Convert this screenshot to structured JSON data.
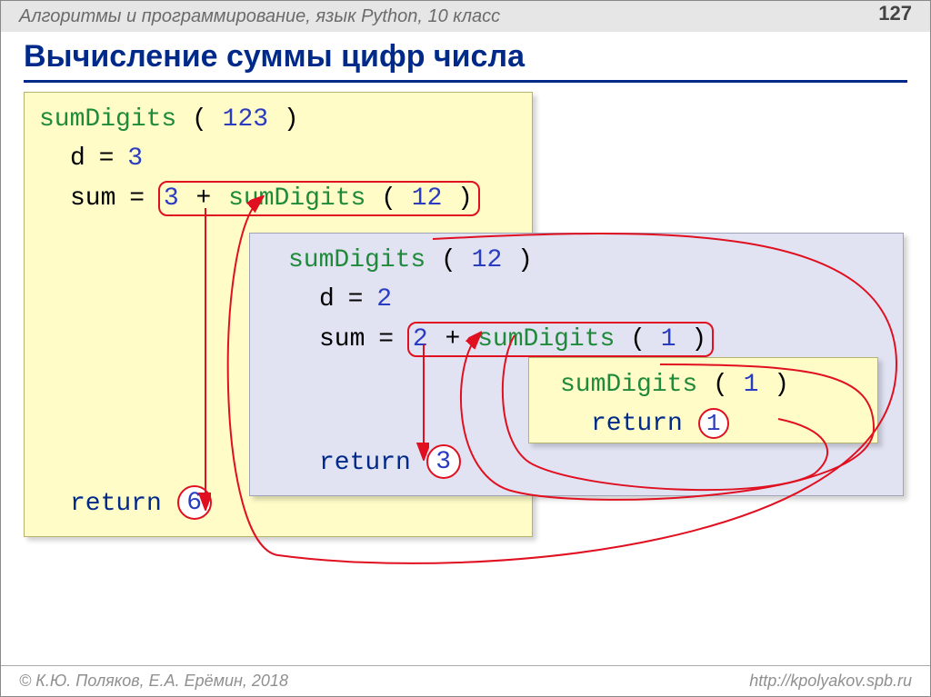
{
  "header": {
    "course": "Алгоритмы и программирование, язык Python, 10 класс",
    "page": "127"
  },
  "title": "Вычисление суммы цифр числа",
  "box1": {
    "fn": "sumDigits",
    "arg": "123",
    "d_line_d": "d",
    "d_line_eq": "=",
    "d_val": "3",
    "sum_word": "sum",
    "sum_eq": "=",
    "sum_left": "3",
    "plus": "+",
    "inner_fn": "sumDigits",
    "inner_arg": "12",
    "return": "return",
    "result": "6"
  },
  "box2": {
    "fn": "sumDigits",
    "arg": "12",
    "d_line_d": "d",
    "d_line_eq": "=",
    "d_val": "2",
    "sum_word": "sum",
    "sum_eq": "=",
    "sum_left": "2",
    "plus": "+",
    "inner_fn": "sumDigits",
    "inner_arg": "1",
    "return": "return",
    "result": "3"
  },
  "box3": {
    "fn": "sumDigits",
    "arg": "1",
    "return": "return",
    "result": "1"
  },
  "footer": {
    "left": "© К.Ю. Поляков, Е.А. Ерёмин, 2018",
    "right": "http://kpolyakov.spb.ru"
  },
  "parens": {
    "l": " ( ",
    "r": " )"
  }
}
